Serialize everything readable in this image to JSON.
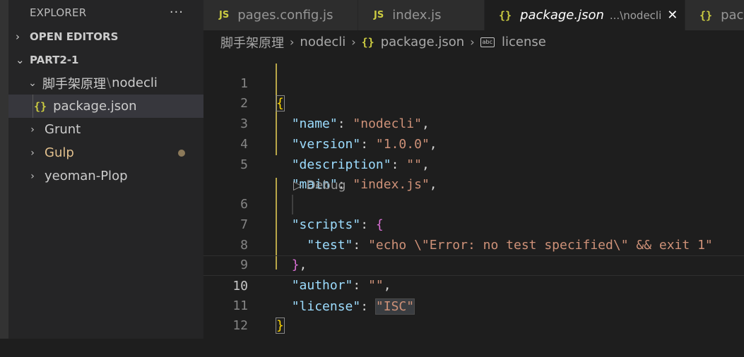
{
  "sidebar": {
    "title": "EXPLORER",
    "more": "···",
    "open_editors": "OPEN EDITORS",
    "workspace": "PART2-1",
    "folder_name": "脚手架原理",
    "folder_sep": "\\",
    "folder_sub": "nodecli",
    "items": [
      {
        "label": "package.json",
        "icon": "{}"
      },
      {
        "label": "Grunt"
      },
      {
        "label": "Gulp"
      },
      {
        "label": "yeoman-Plop"
      }
    ]
  },
  "tabs": [
    {
      "icon": "JS",
      "label": "pages.config.js"
    },
    {
      "icon": "JS",
      "label": "index.js"
    },
    {
      "icon": "{}",
      "label": "package.json",
      "desc": "...\\nodecli",
      "close": "✕"
    },
    {
      "icon": "{}",
      "label": "pack"
    }
  ],
  "breadcrumb": {
    "items": [
      "脚手架原理",
      "nodecli",
      "package.json",
      "license"
    ],
    "json_icon": "{}",
    "abc_icon": "abc",
    "sep": "›"
  },
  "editor": {
    "line_numbers": [
      "1",
      "2",
      "3",
      "4",
      "5",
      "6",
      "7",
      "8",
      "9",
      "10",
      "11",
      "12"
    ],
    "codelens": "▷ Debug",
    "tokens": {
      "open_brace": "{",
      "close_brace": "}",
      "k_name": "\"name\"",
      "s_name": "\"nodecli\"",
      "k_version": "\"version\"",
      "s_version": "\"1.0.0\"",
      "k_description": "\"description\"",
      "s_description": "\"\"",
      "k_main": "\"main\"",
      "s_main": "\"index.js\"",
      "k_scripts": "\"scripts\"",
      "k_test": "\"test\"",
      "s_test": "\"echo \\\"Error: no test specified\\\" && exit 1\"",
      "k_author": "\"author\"",
      "s_author": "\"\"",
      "k_license": "\"license\"",
      "s_license": "\"ISC\"",
      "colon": ": ",
      "comma": ","
    }
  },
  "colors": {
    "key": "#9cdcfe",
    "string": "#ce9178",
    "bracket1": "#ffd700",
    "bracket2": "#da70d6",
    "json_icon": "#cbcb41",
    "modified": "#e2c08d"
  }
}
